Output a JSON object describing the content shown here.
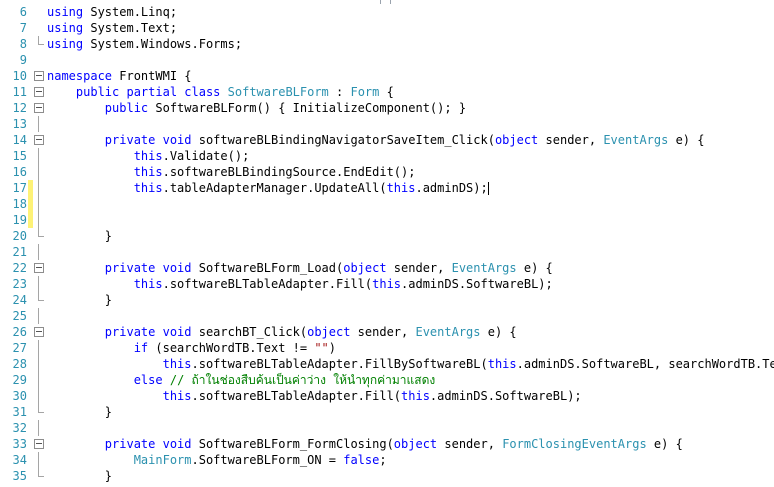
{
  "editor": {
    "lines": [
      {
        "n": "6",
        "mark": "",
        "fold": "",
        "segs": [
          {
            "c": "k",
            "t": "using"
          },
          {
            "t": " System.Linq;"
          }
        ]
      },
      {
        "n": "7",
        "mark": "",
        "fold": "",
        "segs": [
          {
            "c": "k",
            "t": "using"
          },
          {
            "t": " System.Text;"
          }
        ]
      },
      {
        "n": "8",
        "mark": "",
        "fold": "end",
        "segs": [
          {
            "c": "k",
            "t": "using"
          },
          {
            "t": " System.Windows.Forms;"
          }
        ]
      },
      {
        "n": "9",
        "mark": "",
        "fold": "",
        "segs": []
      },
      {
        "n": "10",
        "mark": "",
        "fold": "box",
        "segs": [
          {
            "c": "k",
            "t": "namespace"
          },
          {
            "t": " FrontWMI {"
          }
        ]
      },
      {
        "n": "11",
        "mark": "",
        "fold": "box",
        "segs": [
          {
            "t": "    "
          },
          {
            "c": "k",
            "t": "public partial class"
          },
          {
            "t": " "
          },
          {
            "c": "t",
            "t": "SoftwareBLForm"
          },
          {
            "t": " : "
          },
          {
            "c": "t",
            "t": "Form"
          },
          {
            "t": " {"
          }
        ]
      },
      {
        "n": "12",
        "mark": "",
        "fold": "box",
        "segs": [
          {
            "t": "        "
          },
          {
            "c": "k",
            "t": "public"
          },
          {
            "t": " SoftwareBLForm() { InitializeComponent(); }"
          }
        ]
      },
      {
        "n": "13",
        "mark": "",
        "fold": "line",
        "segs": []
      },
      {
        "n": "14",
        "mark": "",
        "fold": "box",
        "segs": [
          {
            "t": "        "
          },
          {
            "c": "k",
            "t": "private void"
          },
          {
            "t": " softwareBLBindingNavigatorSaveItem_Click("
          },
          {
            "c": "k",
            "t": "object"
          },
          {
            "t": " sender, "
          },
          {
            "c": "t",
            "t": "EventArgs"
          },
          {
            "t": " e) {"
          }
        ]
      },
      {
        "n": "15",
        "mark": "",
        "fold": "line",
        "segs": [
          {
            "t": "            "
          },
          {
            "c": "k",
            "t": "this"
          },
          {
            "t": ".Validate();"
          }
        ]
      },
      {
        "n": "16",
        "mark": "",
        "fold": "line",
        "segs": [
          {
            "t": "            "
          },
          {
            "c": "k",
            "t": "this"
          },
          {
            "t": ".softwareBLBindingSource.EndEdit();"
          }
        ]
      },
      {
        "n": "17",
        "mark": "changed",
        "fold": "line",
        "caret": true,
        "segs": [
          {
            "t": "            "
          },
          {
            "c": "k",
            "t": "this"
          },
          {
            "t": ".tableAdapterManager.UpdateAll("
          },
          {
            "c": "k",
            "t": "this"
          },
          {
            "t": ".adminDS);"
          }
        ]
      },
      {
        "n": "18",
        "mark": "changed",
        "fold": "line",
        "segs": []
      },
      {
        "n": "19",
        "mark": "changed",
        "fold": "line",
        "segs": []
      },
      {
        "n": "20",
        "mark": "",
        "fold": "end",
        "segs": [
          {
            "t": "        }"
          }
        ]
      },
      {
        "n": "21",
        "mark": "",
        "fold": "line",
        "segs": []
      },
      {
        "n": "22",
        "mark": "",
        "fold": "box",
        "segs": [
          {
            "t": "        "
          },
          {
            "c": "k",
            "t": "private void"
          },
          {
            "t": " SoftwareBLForm_Load("
          },
          {
            "c": "k",
            "t": "object"
          },
          {
            "t": " sender, "
          },
          {
            "c": "t",
            "t": "EventArgs"
          },
          {
            "t": " e) {"
          }
        ]
      },
      {
        "n": "23",
        "mark": "",
        "fold": "line",
        "segs": [
          {
            "t": "            "
          },
          {
            "c": "k",
            "t": "this"
          },
          {
            "t": ".softwareBLTableAdapter.Fill("
          },
          {
            "c": "k",
            "t": "this"
          },
          {
            "t": ".adminDS.SoftwareBL);"
          }
        ]
      },
      {
        "n": "24",
        "mark": "",
        "fold": "end",
        "segs": [
          {
            "t": "        }"
          }
        ]
      },
      {
        "n": "25",
        "mark": "",
        "fold": "line",
        "segs": []
      },
      {
        "n": "26",
        "mark": "",
        "fold": "box",
        "segs": [
          {
            "t": "        "
          },
          {
            "c": "k",
            "t": "private void"
          },
          {
            "t": " searchBT_Click("
          },
          {
            "c": "k",
            "t": "object"
          },
          {
            "t": " sender, "
          },
          {
            "c": "t",
            "t": "EventArgs"
          },
          {
            "t": " e) {"
          }
        ]
      },
      {
        "n": "27",
        "mark": "",
        "fold": "line",
        "segs": [
          {
            "t": "            "
          },
          {
            "c": "k",
            "t": "if"
          },
          {
            "t": " (searchWordTB.Text != "
          },
          {
            "c": "s",
            "t": "\"\""
          },
          {
            "t": ")"
          }
        ]
      },
      {
        "n": "28",
        "mark": "",
        "fold": "line",
        "segs": [
          {
            "t": "                "
          },
          {
            "c": "k",
            "t": "this"
          },
          {
            "t": ".softwareBLTableAdapter.FillBySoftwareBL("
          },
          {
            "c": "k",
            "t": "this"
          },
          {
            "t": ".adminDS.SoftwareBL, searchWordTB.Text);"
          }
        ]
      },
      {
        "n": "29",
        "mark": "",
        "fold": "line",
        "segs": [
          {
            "t": "            "
          },
          {
            "c": "k",
            "t": "else"
          },
          {
            "t": " "
          },
          {
            "c": "c",
            "t": "// ถ้าในช่องสืบค้นเป็นค่าว่าง ให้นำทุกค่ามาแสดง"
          }
        ]
      },
      {
        "n": "30",
        "mark": "",
        "fold": "line",
        "segs": [
          {
            "t": "                "
          },
          {
            "c": "k",
            "t": "this"
          },
          {
            "t": ".softwareBLTableAdapter.Fill("
          },
          {
            "c": "k",
            "t": "this"
          },
          {
            "t": ".adminDS.SoftwareBL);"
          }
        ]
      },
      {
        "n": "31",
        "mark": "",
        "fold": "end",
        "segs": [
          {
            "t": "        }"
          }
        ]
      },
      {
        "n": "32",
        "mark": "",
        "fold": "line",
        "segs": []
      },
      {
        "n": "33",
        "mark": "",
        "fold": "box",
        "segs": [
          {
            "t": "        "
          },
          {
            "c": "k",
            "t": "private void"
          },
          {
            "t": " SoftwareBLForm_FormClosing("
          },
          {
            "c": "k",
            "t": "object"
          },
          {
            "t": " sender, "
          },
          {
            "c": "t",
            "t": "FormClosingEventArgs"
          },
          {
            "t": " e) {"
          }
        ]
      },
      {
        "n": "34",
        "mark": "",
        "fold": "line",
        "segs": [
          {
            "t": "            "
          },
          {
            "c": "t",
            "t": "MainForm"
          },
          {
            "t": ".SoftwareBLForm_ON = "
          },
          {
            "c": "k",
            "t": "false"
          },
          {
            "t": ";"
          }
        ]
      },
      {
        "n": "35",
        "mark": "",
        "fold": "end",
        "segs": [
          {
            "t": "        }"
          }
        ]
      }
    ]
  }
}
